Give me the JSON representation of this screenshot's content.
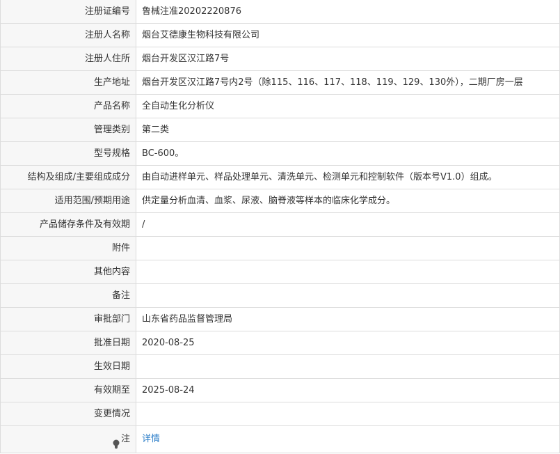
{
  "rows": [
    {
      "label": "注册证编号",
      "value": "鲁械注准20202220876"
    },
    {
      "label": "注册人名称",
      "value": "烟台艾德康生物科技有限公司"
    },
    {
      "label": "注册人住所",
      "value": "烟台开发区汉江路7号"
    },
    {
      "label": "生产地址",
      "value": "烟台开发区汉江路7号内2号（除115、116、117、118、119、129、130外），二期厂房一层"
    },
    {
      "label": "产品名称",
      "value": "全自动生化分析仪"
    },
    {
      "label": "管理类别",
      "value": "第二类"
    },
    {
      "label": "型号规格",
      "value": "BC-600。"
    },
    {
      "label": "结构及组成/主要组成成分",
      "value": "由自动进样单元、样品处理单元、清洗单元、检测单元和控制软件（版本号V1.0）组成。"
    },
    {
      "label": "适用范围/预期用途",
      "value": "供定量分析血清、血浆、尿液、脑脊液等样本的临床化学成分。"
    },
    {
      "label": "产品储存条件及有效期",
      "value": "/"
    },
    {
      "label": "附件",
      "value": ""
    },
    {
      "label": "其他内容",
      "value": ""
    },
    {
      "label": "备注",
      "value": ""
    },
    {
      "label": "审批部门",
      "value": "山东省药品监督管理局"
    },
    {
      "label": "批准日期",
      "value": "2020-08-25"
    },
    {
      "label": "生效日期",
      "value": ""
    },
    {
      "label": "有效期至",
      "value": "2025-08-24"
    },
    {
      "label": "变更情况",
      "value": ""
    }
  ],
  "note_row": {
    "label": "注",
    "icon": "lightbulb-icon",
    "link_text": "详情"
  },
  "colors": {
    "label_bg": "#f7f7f7",
    "border": "#dcdcdc",
    "link": "#2e7fc9"
  }
}
